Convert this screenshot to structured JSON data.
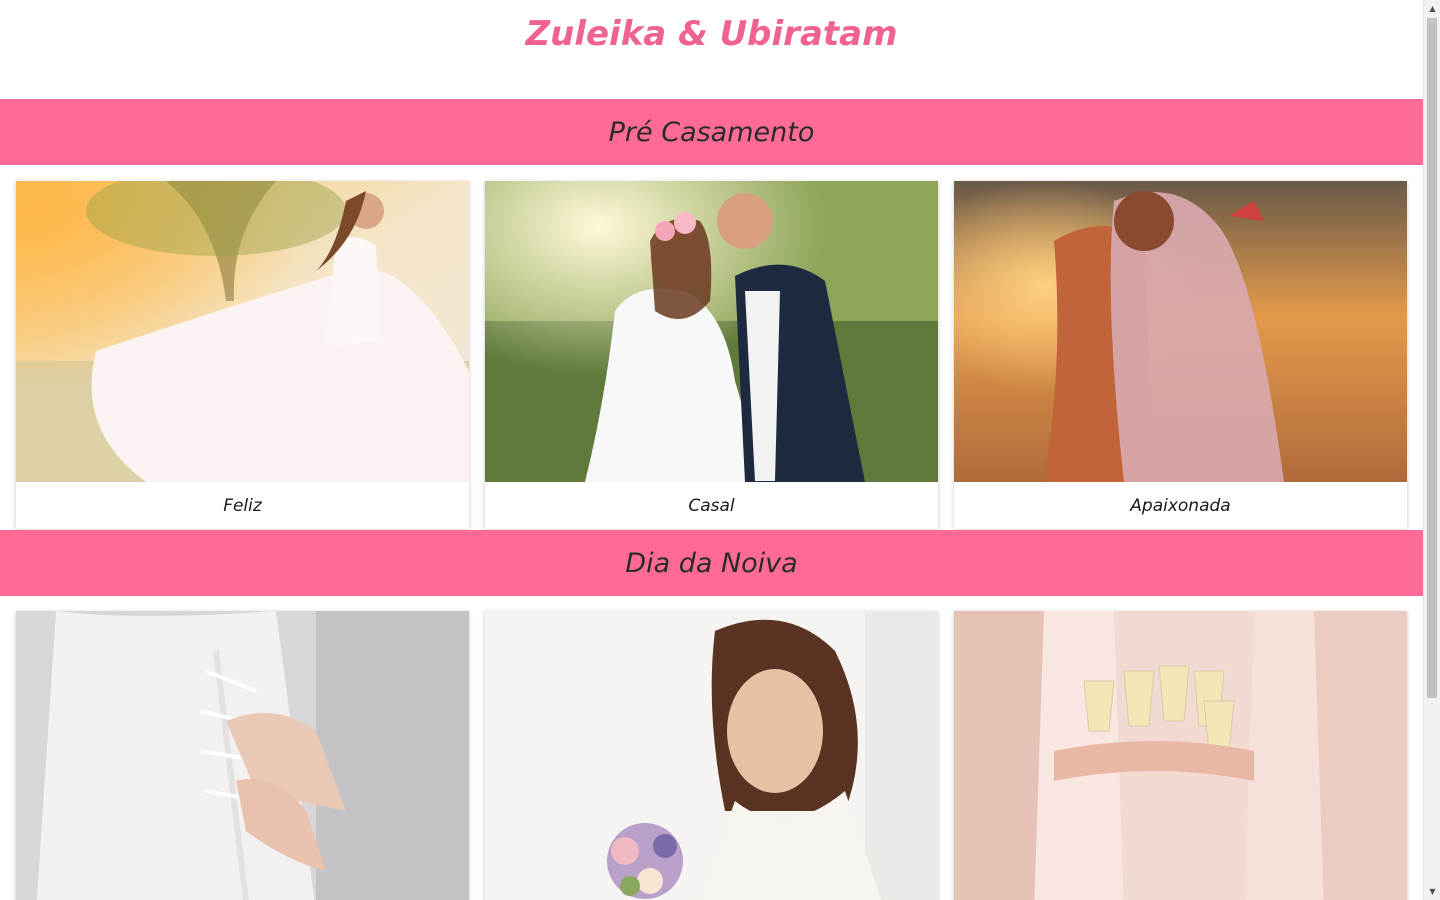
{
  "site": {
    "title": "Zuleika & Ubiratam"
  },
  "colors": {
    "accent": "#ff6b96",
    "title": "#f06292",
    "text": "#2a2a2a"
  },
  "sections": [
    {
      "heading": "Pré Casamento",
      "cards": [
        {
          "caption": "Feliz",
          "image": "bride-twirling-dress-photo"
        },
        {
          "caption": "Casal",
          "image": "bride-and-groom-couple-photo"
        },
        {
          "caption": "Apaixonada",
          "image": "couple-kissing-sunset-photo"
        }
      ]
    },
    {
      "heading": "Dia da Noiva",
      "cards": [
        {
          "caption": "",
          "image": "dress-lacing-detail-photo"
        },
        {
          "caption": "",
          "image": "bride-with-bouquet-photo"
        },
        {
          "caption": "",
          "image": "bridesmaids-toast-champagne-photo"
        }
      ]
    }
  ]
}
